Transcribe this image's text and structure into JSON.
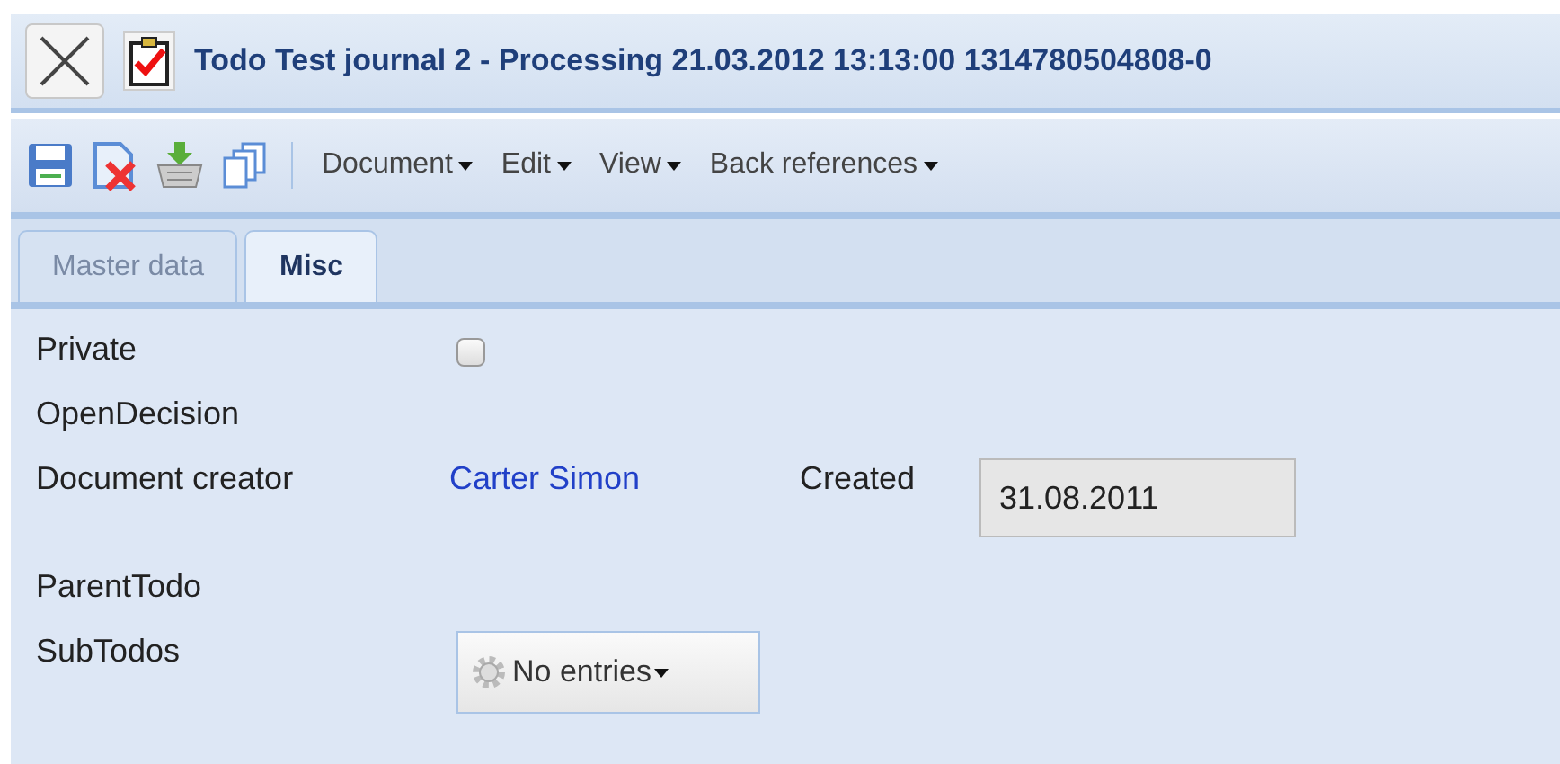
{
  "window": {
    "title": "Todo Test journal 2 - Processing 21.03.2012 13:13:00 1314780504808-0"
  },
  "toolbar": {
    "menus": [
      "Document",
      "Edit",
      "View",
      "Back references"
    ]
  },
  "tabs": [
    {
      "label": "Master data",
      "selected": false
    },
    {
      "label": "Misc",
      "selected": true
    }
  ],
  "form": {
    "private": {
      "label": "Private",
      "checked": false
    },
    "open_decision": {
      "label": "OpenDecision"
    },
    "creator": {
      "label": "Document creator",
      "value": "Carter Simon"
    },
    "created": {
      "label": "Created",
      "value": "31.08.2011"
    },
    "parent_todo": {
      "label": "ParentTodo"
    },
    "sub_todos": {
      "label": "SubTodos",
      "button": "No entries"
    }
  }
}
